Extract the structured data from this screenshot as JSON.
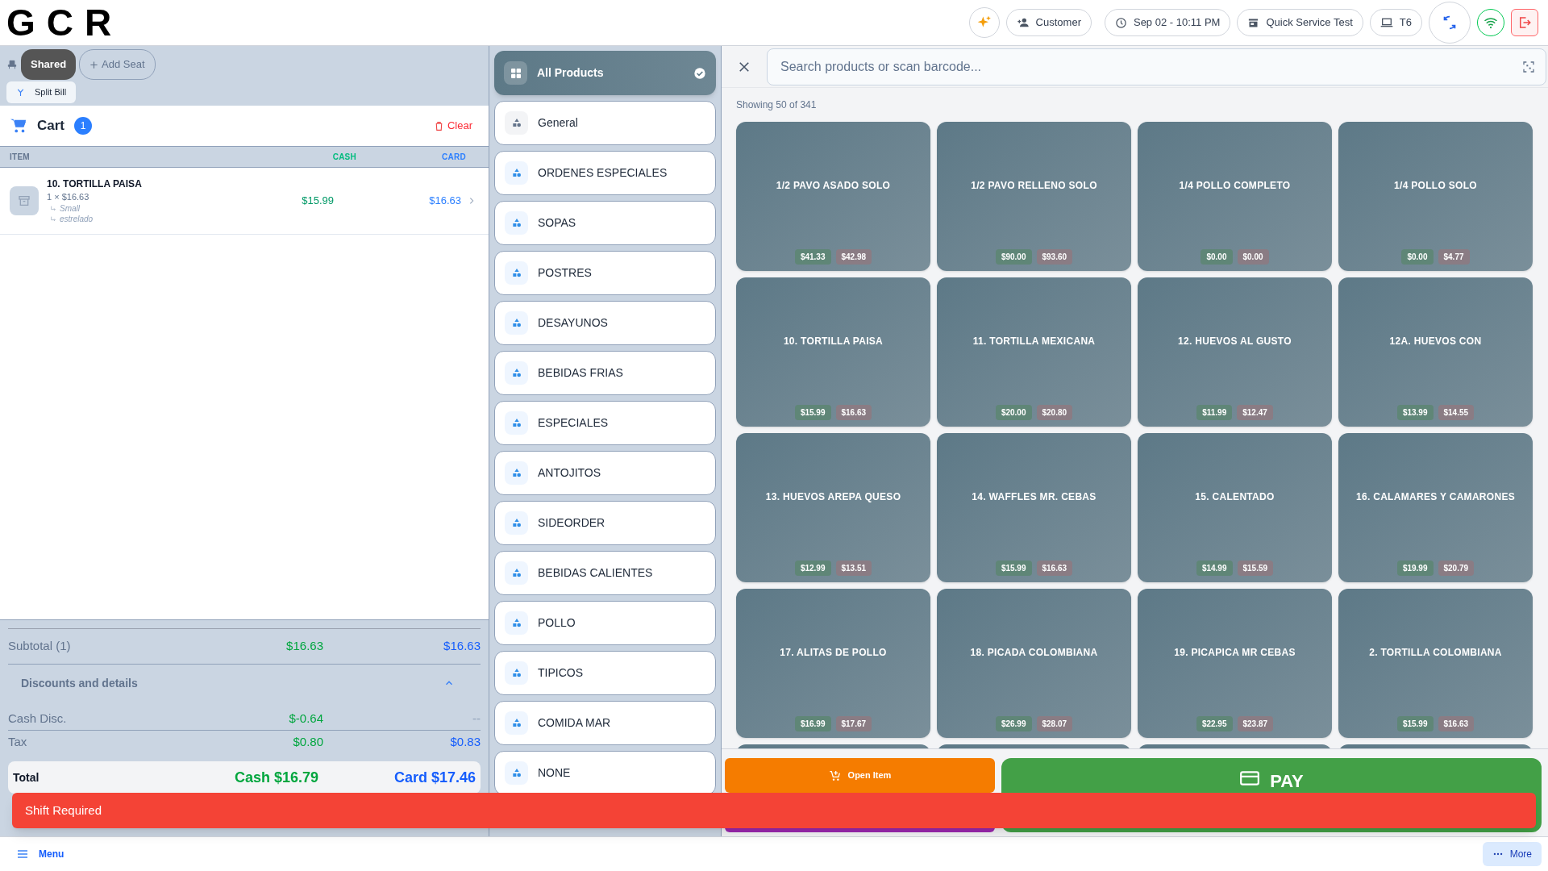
{
  "topbar": {
    "logo": "GCR",
    "customer": "Customer",
    "datetime": "Sep 02 - 10:11 PM",
    "mode": "Quick Service Test",
    "terminal": "T6"
  },
  "seats": {
    "items": [
      {
        "label": "Shared",
        "selected": true
      }
    ],
    "add_seat": "Add Seat",
    "split_bill": "Split Bill"
  },
  "cart": {
    "title": "Cart",
    "count": "1",
    "clear": "Clear",
    "columns": [
      "ITEM",
      "CASH",
      "CARD"
    ],
    "items": [
      {
        "name": "10. TORTILLA PAISA",
        "quantity": "1 × $16.63",
        "modifiers": [
          "Small",
          "estrelado"
        ],
        "cash": "$15.99",
        "card": "$16.63"
      }
    ]
  },
  "summary": {
    "subtotal": {
      "label": "Subtotal (1)",
      "cash": "$16.63",
      "card": "$16.63"
    },
    "discounts": {
      "label": "Discounts and details",
      "expanded": true
    },
    "rows": [
      {
        "label": "Cash Disc.",
        "cash": "$-0.64",
        "card": "--"
      },
      {
        "label": "Tax",
        "cash": "$0.80",
        "card": "$0.83"
      }
    ],
    "total": {
      "label": "Total",
      "cash": "Cash $16.79",
      "card": "Card $17.46"
    }
  },
  "categories": [
    {
      "label": "All Products",
      "kind": "all",
      "selected": true
    },
    {
      "label": "General",
      "kind": "general",
      "selected": false
    },
    {
      "label": "ORDENES ESPECIALES",
      "kind": "category",
      "selected": false
    },
    {
      "label": "SOPAS",
      "kind": "category",
      "selected": false
    },
    {
      "label": "POSTRES",
      "kind": "category",
      "selected": false
    },
    {
      "label": "DESAYUNOS",
      "kind": "category",
      "selected": false
    },
    {
      "label": "BEBIDAS FRIAS",
      "kind": "category",
      "selected": false
    },
    {
      "label": "ESPECIALES",
      "kind": "category",
      "selected": false
    },
    {
      "label": "ANTOJITOS",
      "kind": "category",
      "selected": false
    },
    {
      "label": "SIDEORDER",
      "kind": "category",
      "selected": false
    },
    {
      "label": "BEBIDAS CALIENTES",
      "kind": "category",
      "selected": false
    },
    {
      "label": "POLLO",
      "kind": "category",
      "selected": false
    },
    {
      "label": "TIPICOS",
      "kind": "category",
      "selected": false
    },
    {
      "label": "COMIDA MAR",
      "kind": "category",
      "selected": false
    },
    {
      "label": "NONE",
      "kind": "category",
      "selected": false
    }
  ],
  "search": {
    "placeholder": "Search products or scan barcode..."
  },
  "showing": "Showing 50 of 341",
  "products": [
    {
      "name": "1/2 PAVO ASADO SOLO",
      "cash": "$41.33",
      "card": "$42.98"
    },
    {
      "name": "1/2 PAVO RELLENO SOLO",
      "cash": "$90.00",
      "card": "$93.60"
    },
    {
      "name": "1/4 POLLO COMPLETO",
      "cash": "$0.00",
      "card": "$0.00"
    },
    {
      "name": "1/4 POLLO SOLO",
      "cash": "$0.00",
      "card": "$4.77"
    },
    {
      "name": "10. TORTILLA PAISA",
      "cash": "$15.99",
      "card": "$16.63"
    },
    {
      "name": "11. TORTILLA MEXICANA",
      "cash": "$20.00",
      "card": "$20.80"
    },
    {
      "name": "12. HUEVOS AL GUSTO",
      "cash": "$11.99",
      "card": "$12.47"
    },
    {
      "name": "12A. HUEVOS CON",
      "cash": "$13.99",
      "card": "$14.55"
    },
    {
      "name": "13. HUEVOS AREPA QUESO",
      "cash": "$12.99",
      "card": "$13.51"
    },
    {
      "name": "14. WAFFLES  MR. CEBAS",
      "cash": "$15.99",
      "card": "$16.63"
    },
    {
      "name": "15. CALENTADO",
      "cash": "$14.99",
      "card": "$15.59"
    },
    {
      "name": "16. CALAMARES Y CAMARONES",
      "cash": "$19.99",
      "card": "$20.79"
    },
    {
      "name": "17. ALITAS  DE POLLO",
      "cash": "$16.99",
      "card": "$17.67"
    },
    {
      "name": "18. PICADA COLOMBIANA",
      "cash": "$26.99",
      "card": "$28.07"
    },
    {
      "name": "19. PICAPICA MR CEBAS",
      "cash": "$22.95",
      "card": "$23.87"
    },
    {
      "name": "2. TORTILLA COLOMBIANA",
      "cash": "$15.99",
      "card": "$16.63"
    }
  ],
  "actions": {
    "open_item": "Open Item",
    "pay": "PAY"
  },
  "toast": "Shift Required",
  "bottom": {
    "menu": "Menu",
    "more": "More"
  }
}
